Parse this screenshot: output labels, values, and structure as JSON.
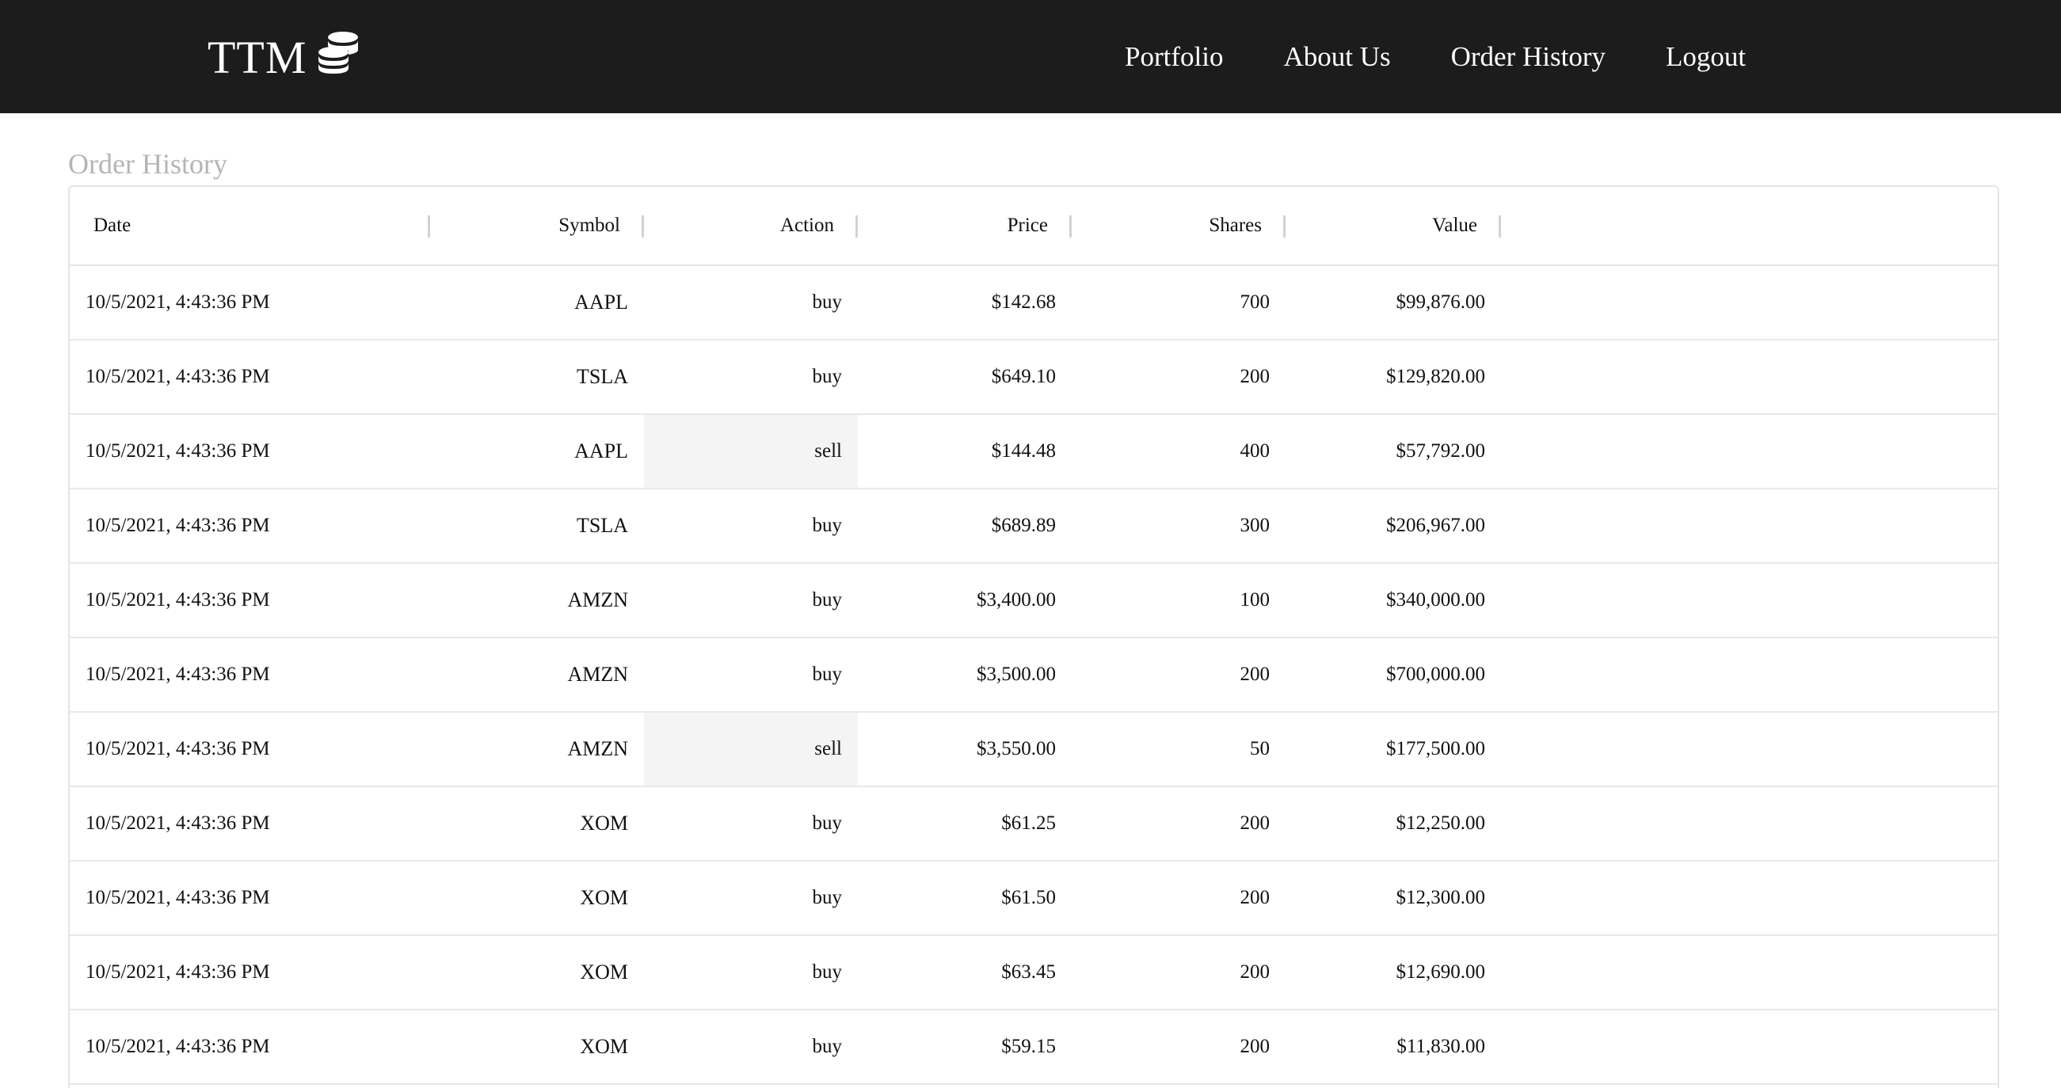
{
  "brand": {
    "name": "TTM",
    "icon": "coins-stack-icon"
  },
  "nav": [
    {
      "label": "Portfolio",
      "name": "nav-portfolio"
    },
    {
      "label": "About Us",
      "name": "nav-about-us"
    },
    {
      "label": "Order History",
      "name": "nav-order-history"
    },
    {
      "label": "Logout",
      "name": "nav-logout"
    }
  ],
  "page": {
    "title": "Order History"
  },
  "table": {
    "columns": {
      "date": "Date",
      "symbol": "Symbol",
      "action": "Action",
      "price": "Price",
      "shares": "Shares",
      "value": "Value"
    },
    "rows": [
      {
        "date": "10/5/2021, 4:43:36 PM",
        "symbol": "AAPL",
        "action": "buy",
        "price": "$142.68",
        "shares": "700",
        "value": "$99,876.00"
      },
      {
        "date": "10/5/2021, 4:43:36 PM",
        "symbol": "TSLA",
        "action": "buy",
        "price": "$649.10",
        "shares": "200",
        "value": "$129,820.00"
      },
      {
        "date": "10/5/2021, 4:43:36 PM",
        "symbol": "AAPL",
        "action": "sell",
        "price": "$144.48",
        "shares": "400",
        "value": "$57,792.00"
      },
      {
        "date": "10/5/2021, 4:43:36 PM",
        "symbol": "TSLA",
        "action": "buy",
        "price": "$689.89",
        "shares": "300",
        "value": "$206,967.00"
      },
      {
        "date": "10/5/2021, 4:43:36 PM",
        "symbol": "AMZN",
        "action": "buy",
        "price": "$3,400.00",
        "shares": "100",
        "value": "$340,000.00"
      },
      {
        "date": "10/5/2021, 4:43:36 PM",
        "symbol": "AMZN",
        "action": "buy",
        "price": "$3,500.00",
        "shares": "200",
        "value": "$700,000.00"
      },
      {
        "date": "10/5/2021, 4:43:36 PM",
        "symbol": "AMZN",
        "action": "sell",
        "price": "$3,550.00",
        "shares": "50",
        "value": "$177,500.00"
      },
      {
        "date": "10/5/2021, 4:43:36 PM",
        "symbol": "XOM",
        "action": "buy",
        "price": "$61.25",
        "shares": "200",
        "value": "$12,250.00"
      },
      {
        "date": "10/5/2021, 4:43:36 PM",
        "symbol": "XOM",
        "action": "buy",
        "price": "$61.50",
        "shares": "200",
        "value": "$12,300.00"
      },
      {
        "date": "10/5/2021, 4:43:36 PM",
        "symbol": "XOM",
        "action": "buy",
        "price": "$63.45",
        "shares": "200",
        "value": "$12,690.00"
      },
      {
        "date": "10/5/2021, 4:43:36 PM",
        "symbol": "XOM",
        "action": "buy",
        "price": "$59.15",
        "shares": "200",
        "value": "$11,830.00"
      }
    ]
  },
  "colors": {
    "header_bg": "#1c1c1c",
    "sell_highlight": "#f4f4f4",
    "title_gray": "#b5b5b5"
  }
}
